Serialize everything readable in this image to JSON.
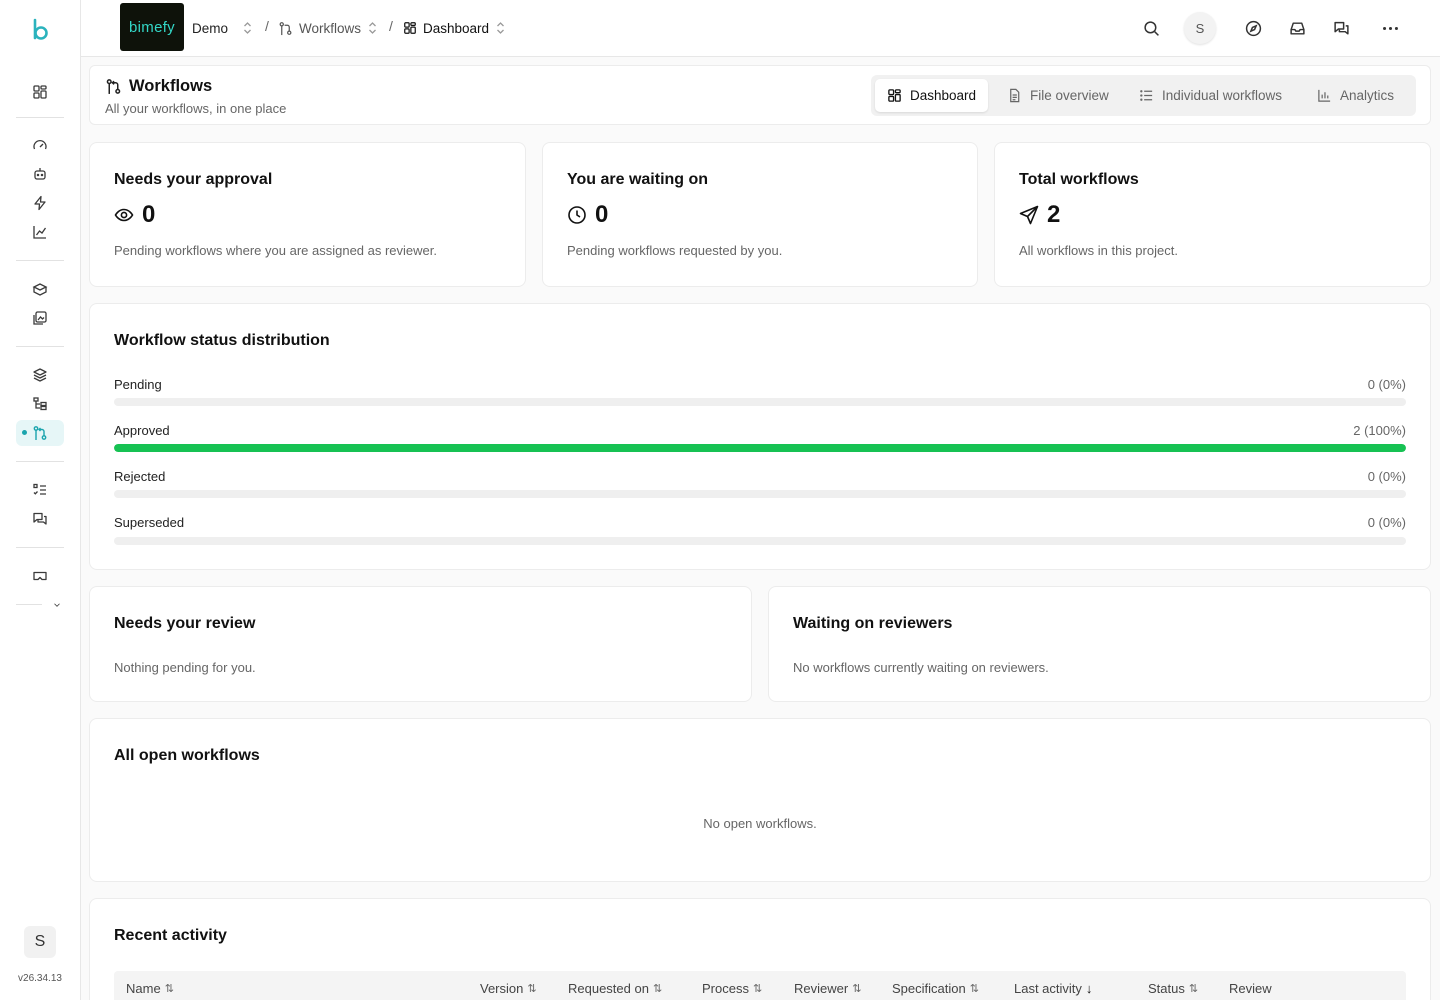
{
  "sidebar": {
    "version": "v26.34.13",
    "avatar_initial": "S"
  },
  "topbar": {
    "brand": "bimefy",
    "breadcrumbs": [
      {
        "label": "Demo"
      },
      {
        "label": "Workflows"
      },
      {
        "label": "Dashboard"
      }
    ],
    "avatar_initial": "S"
  },
  "header": {
    "title": "Workflows",
    "subtitle": "All your workflows, in one place",
    "tabs": [
      {
        "label": "Dashboard",
        "icon": "dashboard-icon",
        "active": true
      },
      {
        "label": "File overview",
        "icon": "file-icon",
        "active": false
      },
      {
        "label": "Individual workflows",
        "icon": "list-icon",
        "active": false
      },
      {
        "label": "Analytics",
        "icon": "bar-chart-icon",
        "active": false
      }
    ]
  },
  "stats": [
    {
      "title": "Needs your approval",
      "value": "0",
      "icon": "eye-icon",
      "desc": "Pending workflows where you are assigned as reviewer."
    },
    {
      "title": "You are waiting on",
      "value": "0",
      "icon": "clock-icon",
      "desc": "Pending workflows requested by you."
    },
    {
      "title": "Total workflows",
      "value": "2",
      "icon": "send-icon",
      "desc": "All workflows in this project."
    }
  ],
  "distribution": {
    "title": "Workflow status distribution",
    "rows": [
      {
        "label": "Pending",
        "value": "0 (0%)",
        "fraction": 0,
        "color": "#e0e0e0"
      },
      {
        "label": "Approved",
        "value": "2 (100%)",
        "fraction": 1,
        "color": "#16c253"
      },
      {
        "label": "Rejected",
        "value": "0 (0%)",
        "fraction": 0,
        "color": "#e0e0e0"
      },
      {
        "label": "Superseded",
        "value": "0 (0%)",
        "fraction": 0,
        "color": "#e0e0e0"
      }
    ]
  },
  "review": {
    "title": "Needs your review",
    "empty": "Nothing pending for you."
  },
  "waiting": {
    "title": "Waiting on reviewers",
    "empty": "No workflows currently waiting on reviewers."
  },
  "open_workflows": {
    "title": "All open workflows",
    "empty": "No open workflows."
  },
  "recent": {
    "title": "Recent activity",
    "columns": [
      {
        "label": "Name",
        "sort": "⇅"
      },
      {
        "label": "Version",
        "sort": "⇅"
      },
      {
        "label": "Requested on",
        "sort": "⇅"
      },
      {
        "label": "Process",
        "sort": "⇅"
      },
      {
        "label": "Reviewer",
        "sort": "⇅"
      },
      {
        "label": "Specification",
        "sort": "⇅"
      },
      {
        "label": "Last activity",
        "sort": "↓"
      },
      {
        "label": "Status",
        "sort": "⇅"
      },
      {
        "label": "Review",
        "sort": ""
      }
    ]
  },
  "colors": {
    "accent": "#1aa4ad",
    "approved": "#16c253"
  }
}
